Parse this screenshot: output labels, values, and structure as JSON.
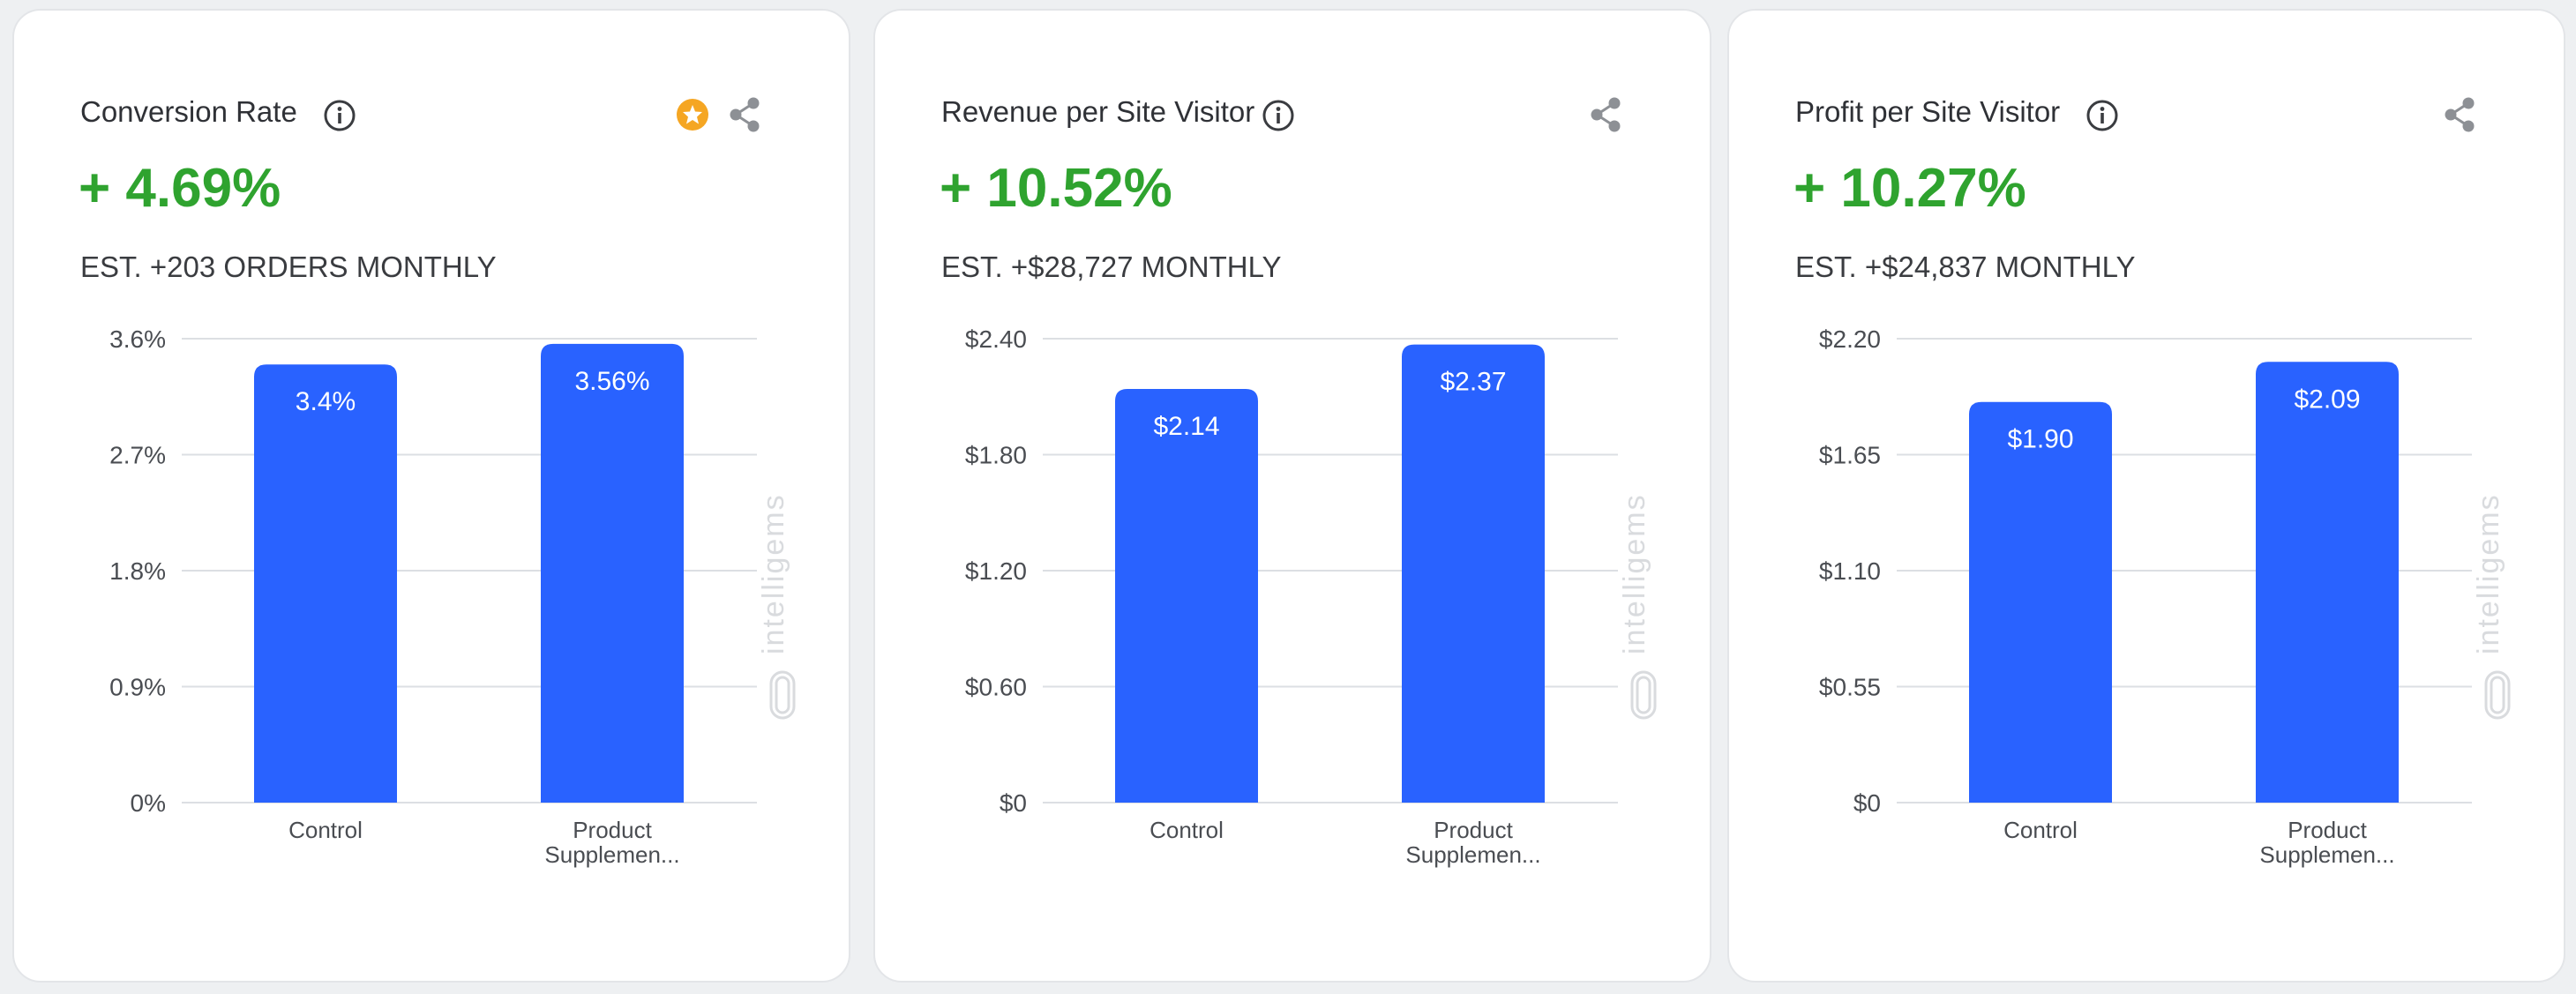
{
  "colors": {
    "bar": "#2962ff",
    "metric": "#2fa32f",
    "star": "#f5a623"
  },
  "watermark": "intelligems",
  "cards": [
    {
      "title": "Conversion Rate",
      "metric": "+ 4.69%",
      "est": "EST. +203 ORDERS MONTHLY",
      "has_star": true,
      "icons": [
        "info-icon",
        "star-icon",
        "share-icon"
      ]
    },
    {
      "title": "Revenue per Site Visitor",
      "metric": "+ 10.52%",
      "est": "EST. +$28,727 MONTHLY",
      "has_star": false,
      "icons": [
        "info-icon",
        "share-icon"
      ]
    },
    {
      "title": "Profit per Site Visitor",
      "metric": "+ 10.27%",
      "est": "EST. +$24,837 MONTHLY",
      "has_star": false,
      "icons": [
        "info-icon",
        "share-icon"
      ]
    }
  ],
  "chart_data": [
    {
      "type": "bar",
      "categories": [
        [
          "Control"
        ],
        [
          "Product",
          "Supplemen..."
        ]
      ],
      "values": [
        3.4,
        3.56
      ],
      "value_labels": [
        "3.4%",
        "3.56%"
      ],
      "yticks": [
        0,
        0.9,
        1.8,
        2.7,
        3.6
      ],
      "ytick_labels": [
        "0%",
        "0.9%",
        "1.8%",
        "2.7%",
        "3.6%"
      ],
      "ylim": [
        0,
        3.6
      ],
      "grid": true
    },
    {
      "type": "bar",
      "categories": [
        [
          "Control"
        ],
        [
          "Product",
          "Supplemen..."
        ]
      ],
      "values": [
        2.14,
        2.37
      ],
      "value_labels": [
        "$2.14",
        "$2.37"
      ],
      "yticks": [
        0,
        0.6,
        1.2,
        1.8,
        2.4
      ],
      "ytick_labels": [
        "$0",
        "$0.60",
        "$1.20",
        "$1.80",
        "$2.40"
      ],
      "ylim": [
        0,
        2.4
      ],
      "grid": true
    },
    {
      "type": "bar",
      "categories": [
        [
          "Control"
        ],
        [
          "Product",
          "Supplemen..."
        ]
      ],
      "values": [
        1.9,
        2.09
      ],
      "value_labels": [
        "$1.90",
        "$2.09"
      ],
      "yticks": [
        0,
        0.55,
        1.1,
        1.65,
        2.2
      ],
      "ytick_labels": [
        "$0",
        "$0.55",
        "$1.10",
        "$1.65",
        "$2.20"
      ],
      "ylim": [
        0,
        2.2
      ],
      "grid": true
    }
  ]
}
